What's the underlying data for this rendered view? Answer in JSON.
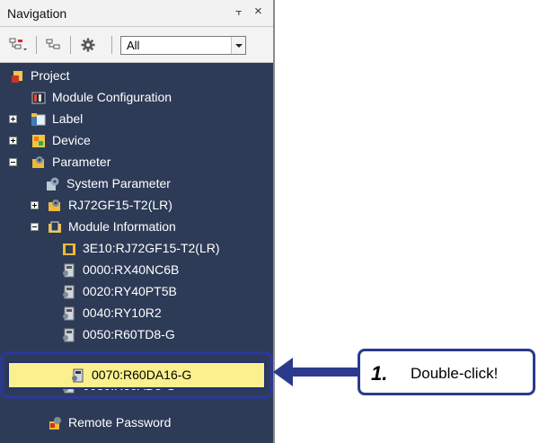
{
  "panel": {
    "title": "Navigation",
    "pin_glyph": "⫟",
    "close_glyph": "×"
  },
  "toolbar": {
    "filter_value": "All"
  },
  "tree": {
    "items": [
      {
        "label": "Project",
        "icon": "project-icon"
      },
      {
        "label": "Module Configuration",
        "icon": "module-configuration-icon"
      },
      {
        "label": "Label",
        "icon": "label-icon"
      },
      {
        "label": "Device",
        "icon": "device-icon"
      },
      {
        "label": "Parameter",
        "icon": "parameter-icon"
      },
      {
        "label": "System Parameter",
        "icon": "system-parameter-icon"
      },
      {
        "label": "RJ72GF15-T2(LR)",
        "icon": "station-icon"
      },
      {
        "label": "Module Information",
        "icon": "module-information-icon"
      },
      {
        "label": "3E10:RJ72GF15-T2(LR)",
        "icon": "module-icon"
      },
      {
        "label": "0000:RX40NC6B",
        "icon": "module-icon"
      },
      {
        "label": "0020:RY40PT5B",
        "icon": "module-icon"
      },
      {
        "label": "0040:RY10R2",
        "icon": "module-icon"
      },
      {
        "label": "0050:R60TD8-G",
        "icon": "module-icon"
      },
      {
        "label": "0070:R60DA16-G",
        "icon": "module-icon"
      },
      {
        "label": "0080:R60AD8-G",
        "icon": "module-icon"
      },
      {
        "label": "Remote Password",
        "icon": "remote-password-icon"
      }
    ]
  },
  "callout": {
    "number": "1.",
    "text": "Double-click!"
  },
  "colors": {
    "tree_background": "#2d3b57",
    "highlight": "#fbf08e",
    "accent": "#2b3a8c"
  }
}
